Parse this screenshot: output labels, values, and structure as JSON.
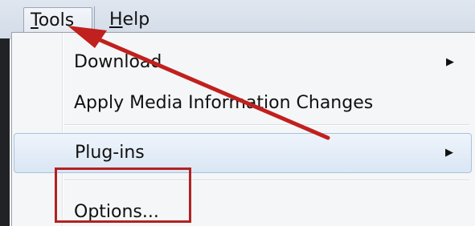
{
  "menubar": {
    "tools_accel": "T",
    "tools_rest": "ools",
    "help_accel": "H",
    "help_rest": "elp"
  },
  "tools_menu": {
    "items": [
      {
        "label": "Download",
        "has_submenu": true
      },
      {
        "label": "Apply Media Information Changes",
        "has_submenu": false
      },
      {
        "label": "Plug-ins",
        "has_submenu": true,
        "highlighted": true
      },
      {
        "label": "Options...",
        "has_submenu": false
      }
    ],
    "submenu_glyph": "▶"
  },
  "annotations": {
    "arrow_color": "#c0201e",
    "box_color": "#b22222",
    "arrow_target": "Tools",
    "box_target": "Options..."
  }
}
